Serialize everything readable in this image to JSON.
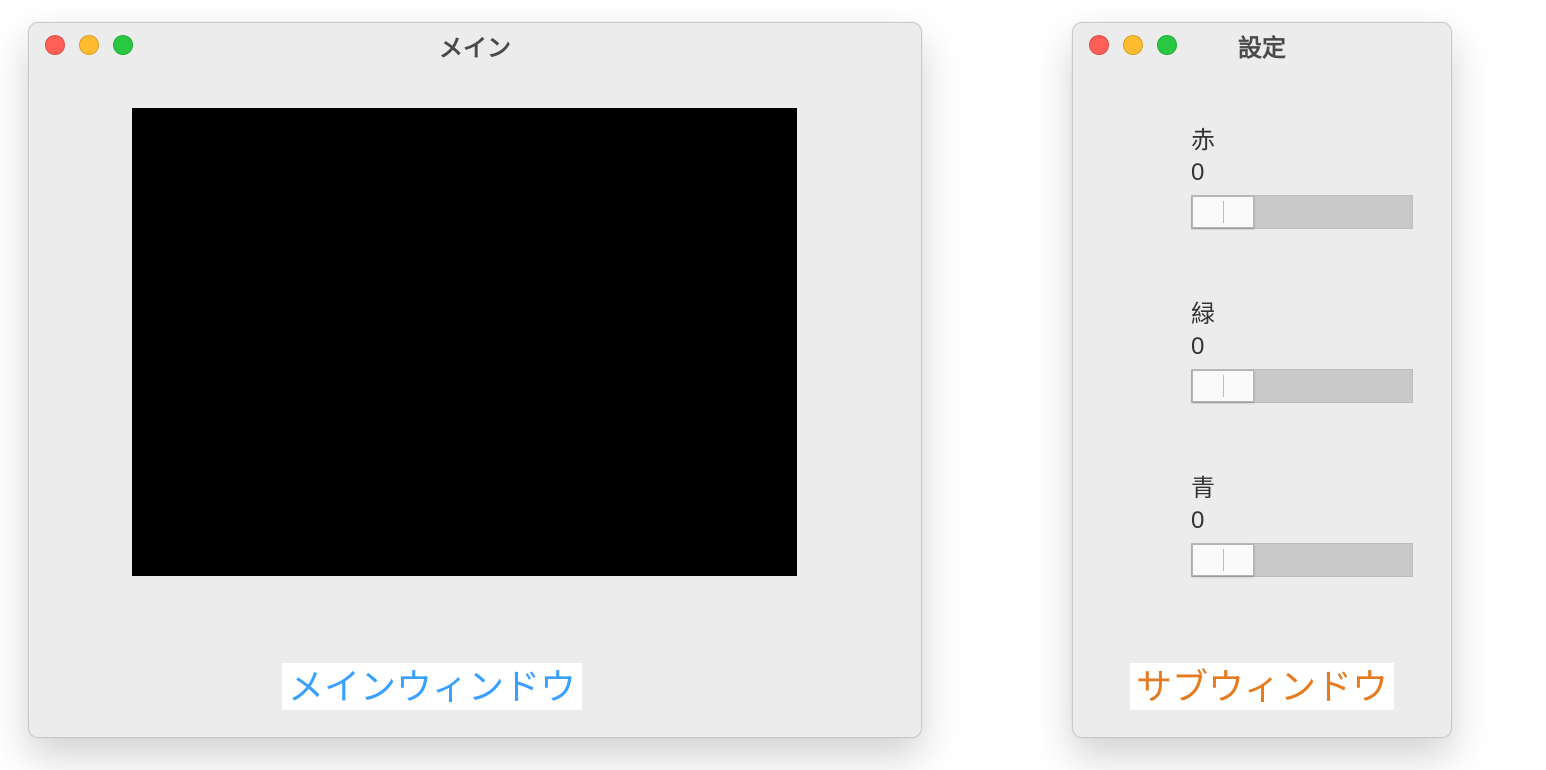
{
  "main_window": {
    "title": "メイン",
    "canvas_color": "#000000",
    "caption": "メインウィンドウ"
  },
  "sub_window": {
    "title": "設定",
    "caption": "サブウィンドウ",
    "sliders": [
      {
        "label": "赤",
        "value": "0"
      },
      {
        "label": "緑",
        "value": "0"
      },
      {
        "label": "青",
        "value": "0"
      }
    ]
  }
}
